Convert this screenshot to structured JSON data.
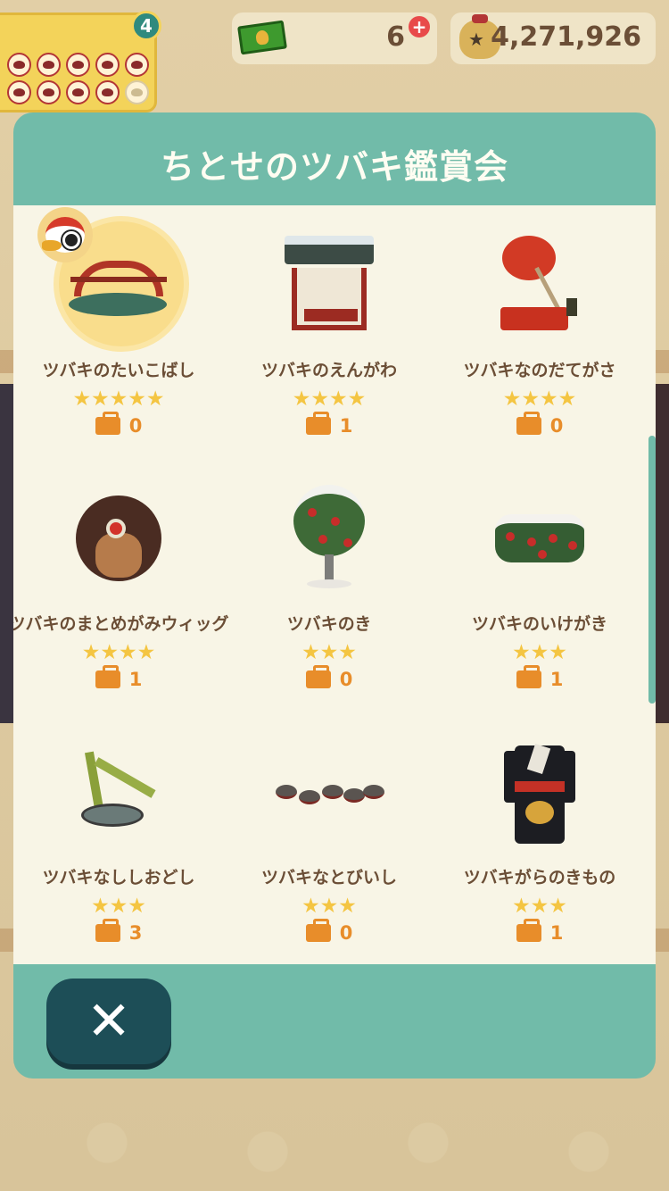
{
  "hud": {
    "stamp_count": "4",
    "tickets": "6",
    "bells": "4,271,926",
    "plus_symbol": "+"
  },
  "modal": {
    "title": "ちとせのツバキ鑑賞会",
    "close_symbol": "✕"
  },
  "items": [
    {
      "name": "ツバキのたいこばし",
      "stars": 5,
      "stars_text": "★★★★★",
      "owned": "0"
    },
    {
      "name": "ツバキのえんがわ",
      "stars": 4,
      "stars_text": "★★★★",
      "owned": "1"
    },
    {
      "name": "ツバキなのだてがさ",
      "stars": 4,
      "stars_text": "★★★★",
      "owned": "0"
    },
    {
      "name": "ツバキのまとめがみウィッグ",
      "stars": 4,
      "stars_text": "★★★★",
      "owned": "1"
    },
    {
      "name": "ツバキのき",
      "stars": 3,
      "stars_text": "★★★",
      "owned": "0"
    },
    {
      "name": "ツバキのいけがき",
      "stars": 3,
      "stars_text": "★★★",
      "owned": "1"
    },
    {
      "name": "ツバキなししおどし",
      "stars": 3,
      "stars_text": "★★★",
      "owned": "3"
    },
    {
      "name": "ツバキなとびいし",
      "stars": 3,
      "stars_text": "★★★",
      "owned": "0"
    },
    {
      "name": "ツバキがらのきもの",
      "stars": 3,
      "stars_text": "★★★",
      "owned": "1"
    }
  ],
  "colors": {
    "modal_teal": "#71bba9",
    "panel_cream": "#f8f5e6",
    "text_brown": "#6b4e36",
    "star_gold": "#f4c542",
    "owned_orange": "#e88d2a",
    "close_dark": "#1d4e57"
  }
}
